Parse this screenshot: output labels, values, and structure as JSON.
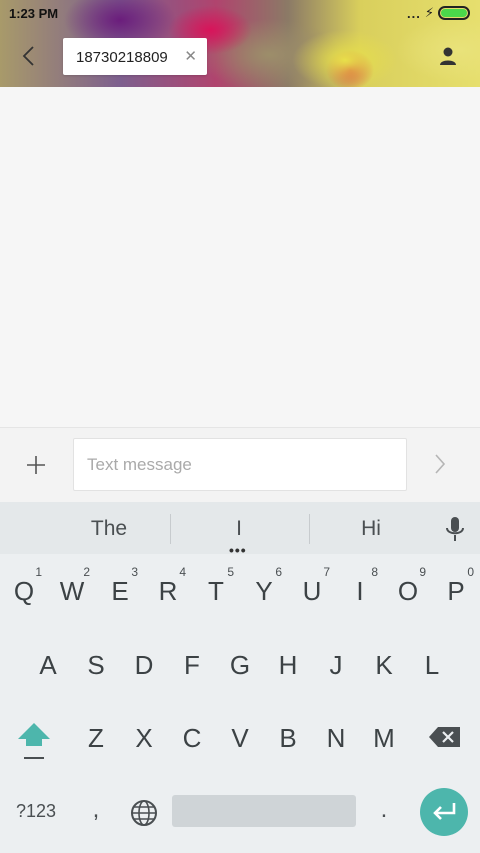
{
  "status_bar": {
    "time": "1:23 PM",
    "signal_dots": "...",
    "battery_color": "#4bd84b"
  },
  "header": {
    "back_icon": "chevron-left-icon",
    "recipient": "18730218809",
    "remove_icon": "close-icon",
    "contact_icon": "person-icon"
  },
  "compose": {
    "attach_icon": "plus-icon",
    "placeholder": "Text message",
    "value": "",
    "send_icon": "chevron-right-icon"
  },
  "keyboard": {
    "suggestions": [
      "The",
      "I",
      "Hi"
    ],
    "accent_color": "#4db6ac",
    "row1": [
      {
        "key": "Q",
        "hint": "1"
      },
      {
        "key": "W",
        "hint": "2"
      },
      {
        "key": "E",
        "hint": "3"
      },
      {
        "key": "R",
        "hint": "4"
      },
      {
        "key": "T",
        "hint": "5"
      },
      {
        "key": "Y",
        "hint": "6"
      },
      {
        "key": "U",
        "hint": "7"
      },
      {
        "key": "I",
        "hint": "8"
      },
      {
        "key": "O",
        "hint": "9"
      },
      {
        "key": "P",
        "hint": "0"
      }
    ],
    "row2": [
      "A",
      "S",
      "D",
      "F",
      "G",
      "H",
      "J",
      "K",
      "L"
    ],
    "row3": [
      "Z",
      "X",
      "C",
      "V",
      "B",
      "N",
      "M"
    ],
    "symbols_label": "?123",
    "comma": ",",
    "period": "."
  }
}
